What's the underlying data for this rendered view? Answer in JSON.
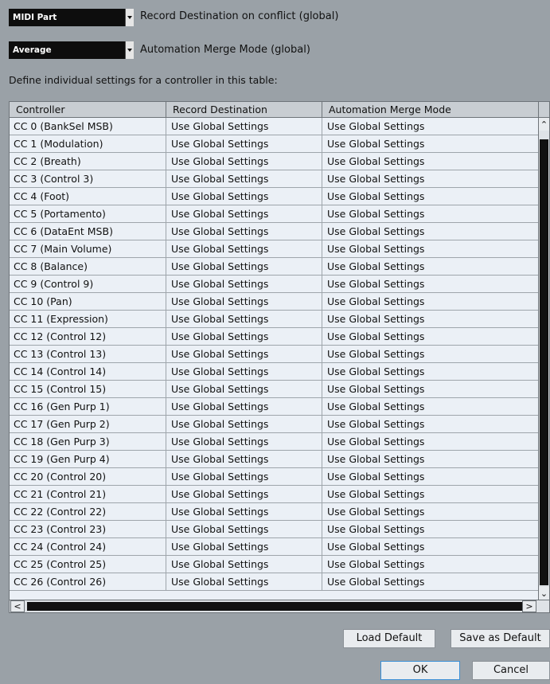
{
  "controls": {
    "record_destination": {
      "value": "MIDI Part",
      "label": "Record Destination on conflict (global)"
    },
    "automation_merge_mode": {
      "value": "Average",
      "label": "Automation Merge Mode (global)"
    },
    "hint": "Define individual settings for a controller in this table:"
  },
  "table": {
    "columns": [
      "Controller",
      "Record Destination",
      "Automation Merge Mode"
    ],
    "rows": [
      [
        "CC 0  (BankSel MSB)",
        "Use Global Settings",
        "Use Global Settings"
      ],
      [
        "CC 1  (Modulation)",
        "Use Global Settings",
        "Use Global Settings"
      ],
      [
        "CC 2  (Breath)",
        "Use Global Settings",
        "Use Global Settings"
      ],
      [
        "CC 3  (Control 3)",
        "Use Global Settings",
        "Use Global Settings"
      ],
      [
        "CC 4  (Foot)",
        "Use Global Settings",
        "Use Global Settings"
      ],
      [
        "CC 5  (Portamento)",
        "Use Global Settings",
        "Use Global Settings"
      ],
      [
        "CC 6  (DataEnt MSB)",
        "Use Global Settings",
        "Use Global Settings"
      ],
      [
        "CC 7  (Main Volume)",
        "Use Global Settings",
        "Use Global Settings"
      ],
      [
        "CC 8  (Balance)",
        "Use Global Settings",
        "Use Global Settings"
      ],
      [
        "CC 9  (Control 9)",
        "Use Global Settings",
        "Use Global Settings"
      ],
      [
        "CC 10  (Pan)",
        "Use Global Settings",
        "Use Global Settings"
      ],
      [
        "CC 11  (Expression)",
        "Use Global Settings",
        "Use Global Settings"
      ],
      [
        "CC 12  (Control 12)",
        "Use Global Settings",
        "Use Global Settings"
      ],
      [
        "CC 13  (Control 13)",
        "Use Global Settings",
        "Use Global Settings"
      ],
      [
        "CC 14  (Control 14)",
        "Use Global Settings",
        "Use Global Settings"
      ],
      [
        "CC 15  (Control 15)",
        "Use Global Settings",
        "Use Global Settings"
      ],
      [
        "CC 16  (Gen Purp 1)",
        "Use Global Settings",
        "Use Global Settings"
      ],
      [
        "CC 17  (Gen Purp 2)",
        "Use Global Settings",
        "Use Global Settings"
      ],
      [
        "CC 18  (Gen Purp 3)",
        "Use Global Settings",
        "Use Global Settings"
      ],
      [
        "CC 19  (Gen Purp 4)",
        "Use Global Settings",
        "Use Global Settings"
      ],
      [
        "CC 20  (Control 20)",
        "Use Global Settings",
        "Use Global Settings"
      ],
      [
        "CC 21  (Control 21)",
        "Use Global Settings",
        "Use Global Settings"
      ],
      [
        "CC 22  (Control 22)",
        "Use Global Settings",
        "Use Global Settings"
      ],
      [
        "CC 23  (Control 23)",
        "Use Global Settings",
        "Use Global Settings"
      ],
      [
        "CC 24  (Control 24)",
        "Use Global Settings",
        "Use Global Settings"
      ],
      [
        "CC 25  (Control 25)",
        "Use Global Settings",
        "Use Global Settings"
      ],
      [
        "CC 26  (Control 26)",
        "Use Global Settings",
        "Use Global Settings"
      ]
    ]
  },
  "buttons": {
    "load_default": "Load Default",
    "save_as_default": "Save as Default",
    "ok": "OK",
    "cancel": "Cancel"
  },
  "colors": {
    "background": "#9aa1a7",
    "table_row": "#ebf0f6",
    "combo_bg": "#0d0d0d",
    "ok_border": "#3b8fd6"
  }
}
